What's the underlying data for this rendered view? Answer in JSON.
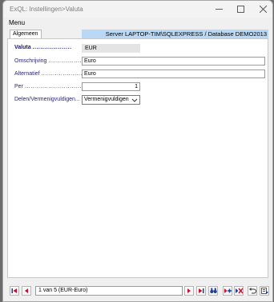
{
  "window": {
    "title": "ExQL: Instellingen>Valuta"
  },
  "menu": {
    "items": [
      "Menu"
    ]
  },
  "tabs": [
    {
      "label": "Algemeen"
    }
  ],
  "server_banner": "Server LAPTOP-TIM\\SQLEXPRESS / Database DEMO2013",
  "form": {
    "valuta": {
      "label": "Valuta",
      "dots": "....................",
      "value": "EUR"
    },
    "omschrijving": {
      "label": "Omschrijving",
      "dots": ".................",
      "value": "Euro"
    },
    "alternatief": {
      "label": "Alternatief",
      "dots": "......................",
      "value": "Euro"
    },
    "per": {
      "label": "Per",
      "dots": ".................................",
      "value": "1"
    },
    "delen": {
      "label": "Delen/Vermenigvuldigen...",
      "selected": "Vermenigvuldigen"
    }
  },
  "navigator": {
    "record": "1 van 5 (EUR-Euro)"
  },
  "colors": {
    "label": "#1f1f8c",
    "banner": "#b9d8f5",
    "nav_red": "#c8102e",
    "nav_blue": "#1b3f99"
  },
  "icons": [
    "first-record-icon",
    "previous-record-icon",
    "next-record-icon",
    "last-record-icon",
    "binoculars-icon",
    "insert-record-icon",
    "delete-record-icon",
    "undo-icon",
    "save-record-icon"
  ]
}
